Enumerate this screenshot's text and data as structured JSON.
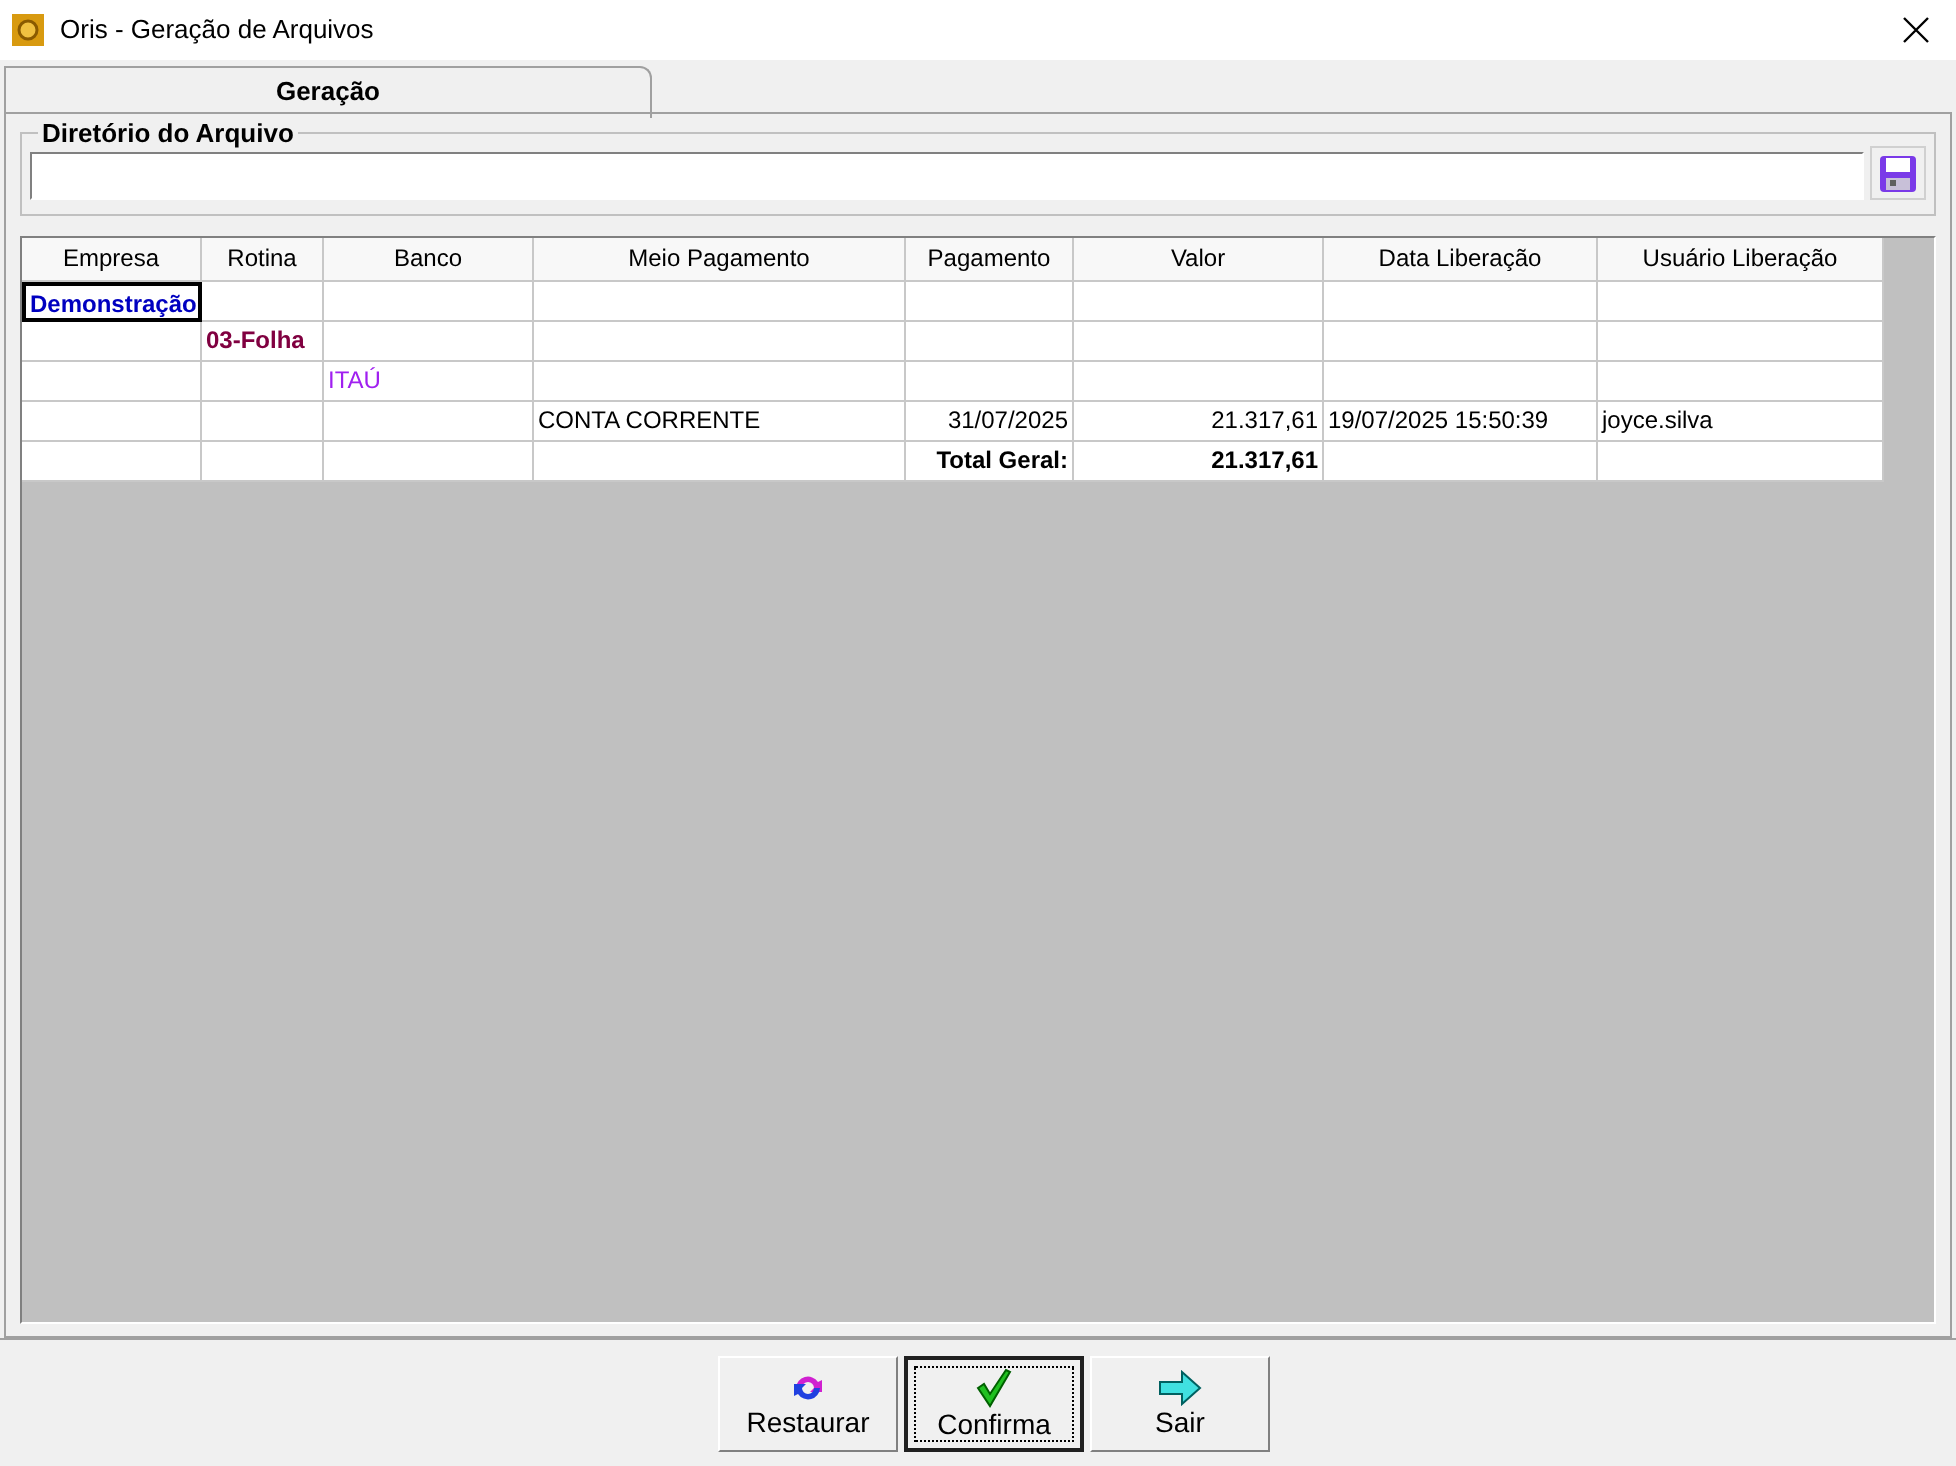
{
  "window": {
    "title": "Oris - Geração de Arquivos"
  },
  "tabs": [
    {
      "label": "Geração",
      "selected": true
    }
  ],
  "directory": {
    "label": "Diretório do Arquivo"
  },
  "table": {
    "columns": [
      "Empresa",
      "Rotina",
      "Banco",
      "Meio Pagamento",
      "Pagamento",
      "Valor",
      "Data Liberação",
      "Usuário Liberação"
    ],
    "rows": [
      {
        "kind": "empresa",
        "selected": true,
        "cells": [
          "Demonstração",
          "",
          "",
          "",
          "",
          "",
          "",
          ""
        ]
      },
      {
        "kind": "rotina",
        "selected": false,
        "cells": [
          "",
          "03-Folha",
          "",
          "",
          "",
          "",
          "",
          ""
        ]
      },
      {
        "kind": "banco",
        "selected": false,
        "cells": [
          "",
          "",
          "ITAÚ",
          "",
          "",
          "",
          "",
          ""
        ]
      },
      {
        "kind": "detail",
        "selected": false,
        "cells": [
          "",
          "",
          "",
          "CONTA CORRENTE",
          "31/07/2025",
          "21.317,61",
          "19/07/2025 15:50:39",
          "joyce.silva"
        ]
      },
      {
        "kind": "total",
        "selected": false,
        "cells": [
          "",
          "",
          "",
          "",
          "Total Geral:",
          "21.317,61",
          "",
          ""
        ]
      }
    ]
  },
  "buttons": [
    {
      "kind": "restore",
      "label": "Restaurar",
      "selected": false
    },
    {
      "kind": "confirm",
      "label": "Confirma",
      "selected": true
    },
    {
      "kind": "exit",
      "label": "Sair",
      "selected": false
    }
  ]
}
